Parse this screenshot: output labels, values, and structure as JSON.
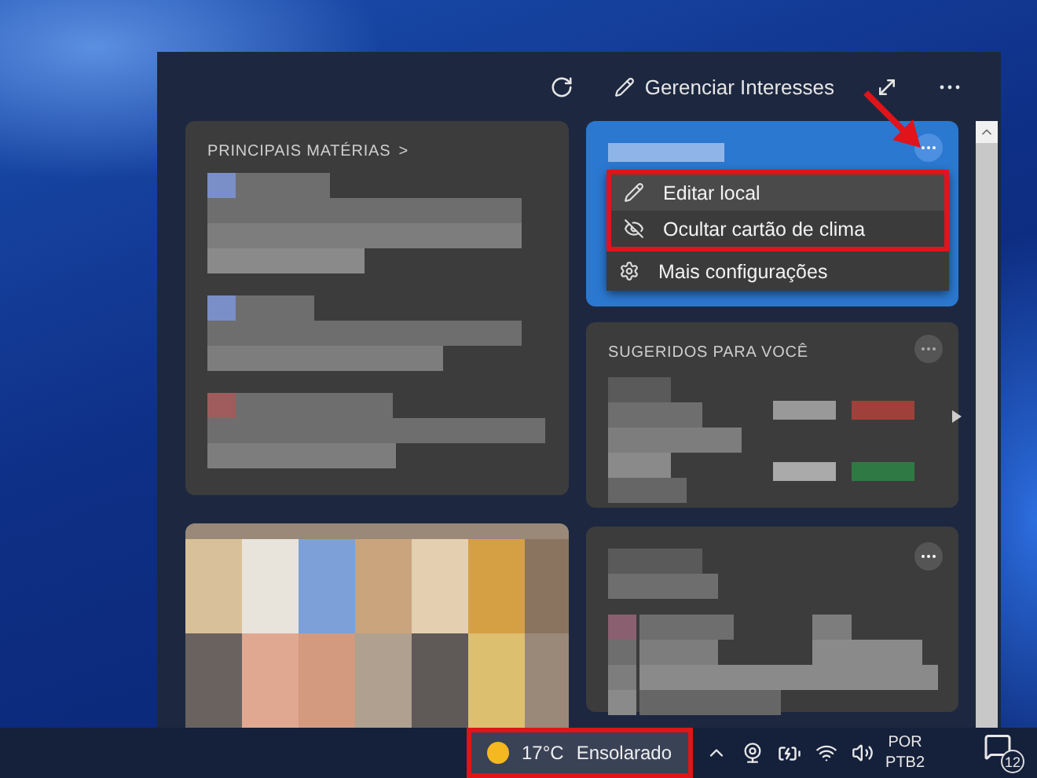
{
  "panel": {
    "header": {
      "manage_label": "Gerenciar Interesses"
    },
    "top_stories": {
      "title": "PRINCIPAIS MATÉRIAS",
      "chevron": ">"
    },
    "weather_card": {
      "menu": [
        {
          "kind": "edit",
          "label": "Editar local",
          "selected": true,
          "highlighted": true
        },
        {
          "kind": "hide",
          "label": "Ocultar cartão de clima",
          "selected": false,
          "highlighted": true
        },
        {
          "kind": "settings",
          "label": "Mais configurações",
          "selected": false,
          "highlighted": false
        }
      ]
    },
    "suggested": {
      "title": "SUGERIDOS PARA VOCÊ"
    }
  },
  "taskbar": {
    "weather": {
      "temperature": "17°C",
      "condition": "Ensolarado",
      "highlighted": true
    },
    "language": [
      "POR",
      "PTB2"
    ],
    "notifications": "12"
  }
}
